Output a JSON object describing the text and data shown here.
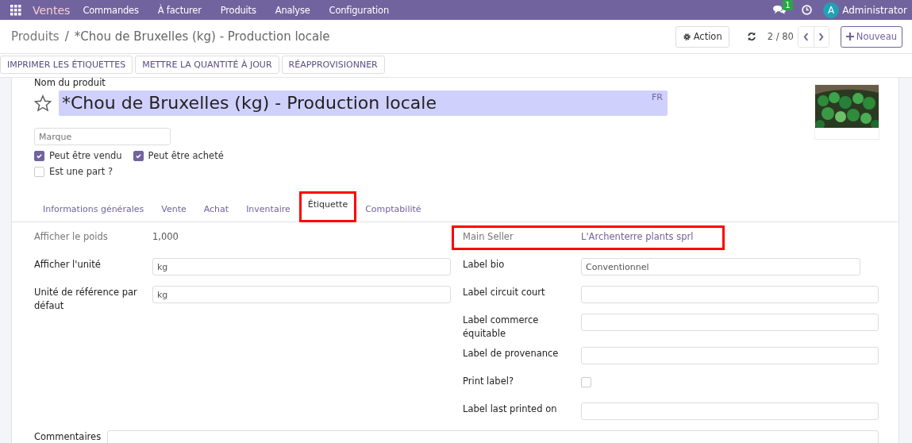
{
  "navbar": {
    "app": "Ventes",
    "menu": [
      "Commandes",
      "À facturer",
      "Produits",
      "Analyse",
      "Configuration"
    ],
    "messages_badge": "1",
    "user_initial": "A",
    "user": "Administrator"
  },
  "breadcrumb": {
    "parent": "Produits",
    "separator": "/",
    "current": "*Chou de Bruxelles (kg) - Production locale"
  },
  "control": {
    "action": "Action",
    "pager": "2 / 80",
    "new": "Nouveau"
  },
  "buttons": [
    "IMPRIMER LES ÉTIQUETTES",
    "METTRE LA QUANTITÉ À JOUR",
    "RÉAPPROVISIONNER"
  ],
  "product": {
    "name_label": "Nom du produit",
    "favorite": false,
    "name": "*Chou de Bruxelles (kg) - Production locale",
    "lang": "FR",
    "brand_placeholder": "Marque",
    "checks": [
      {
        "label": "Peut être vendu",
        "checked": true
      },
      {
        "label": "Peut être acheté",
        "checked": true
      }
    ],
    "part": {
      "label": "Est une part ?",
      "checked": false
    }
  },
  "tabs": [
    {
      "label": "Informations générales",
      "selected": false,
      "highlighted": false
    },
    {
      "label": "Vente",
      "selected": false,
      "highlighted": false
    },
    {
      "label": "Achat",
      "selected": false,
      "highlighted": false
    },
    {
      "label": "Inventaire",
      "selected": false,
      "highlighted": false
    },
    {
      "label": "Étiquette",
      "selected": true,
      "highlighted": true
    },
    {
      "label": "Comptabilité",
      "selected": false,
      "highlighted": false
    }
  ],
  "left_fields": [
    {
      "kind": "readonly",
      "label": "Afficher le poids",
      "value": "1,000"
    },
    {
      "kind": "input",
      "label": "Afficher l'unité",
      "value": "kg"
    },
    {
      "kind": "input",
      "label": "Unité de référence par défaut",
      "value": "kg"
    }
  ],
  "right_fields": [
    {
      "kind": "link",
      "label": "Main Seller",
      "value": "L'Archenterre plants sprl",
      "highlighted": true
    },
    {
      "kind": "input",
      "label": "Label bio",
      "value": "Conventionnel",
      "short": true
    },
    {
      "kind": "input",
      "label": "Label circuit court"
    },
    {
      "kind": "input",
      "label": "Label commerce équitable"
    },
    {
      "kind": "input",
      "label": "Label de provenance"
    },
    {
      "kind": "checkbox",
      "label": "Print label?",
      "checked": false
    },
    {
      "kind": "input",
      "label": "Label last printed on"
    }
  ],
  "comments_label": "Commentaires"
}
